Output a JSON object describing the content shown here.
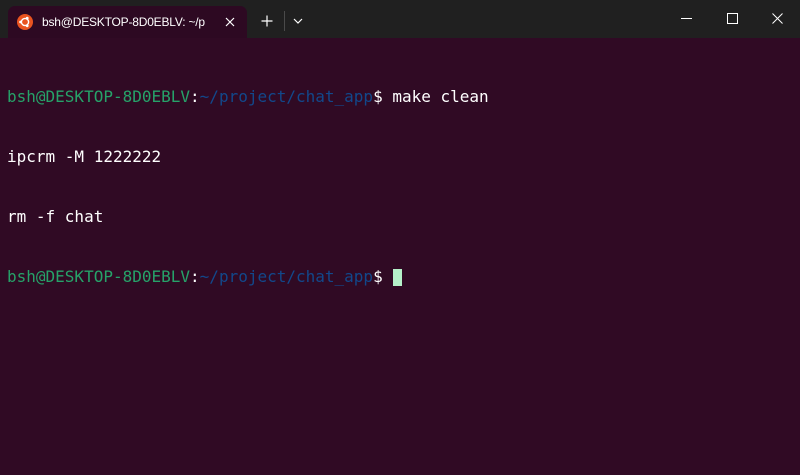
{
  "window": {
    "tab_title": "bsh@DESKTOP-8D0EBLV: ~/p",
    "tab_icon": "ubuntu-logo-icon",
    "accent_color": "#e95420",
    "new_tab_glyph": "+",
    "controls": [
      "minimize-icon",
      "maximize-icon",
      "close-icon"
    ]
  },
  "terminal": {
    "background": "#300a24",
    "prompt_user": "bsh@DESKTOP-8D0EBLV",
    "prompt_colon": ":",
    "prompt_path": "~/project/chat_app",
    "prompt_sigil": "$",
    "lines": [
      {
        "type": "prompt",
        "command": " make clean"
      },
      {
        "type": "output",
        "text": "ipcrm -M 1222222"
      },
      {
        "type": "output",
        "text": "rm -f chat"
      },
      {
        "type": "prompt",
        "command": " "
      }
    ]
  }
}
